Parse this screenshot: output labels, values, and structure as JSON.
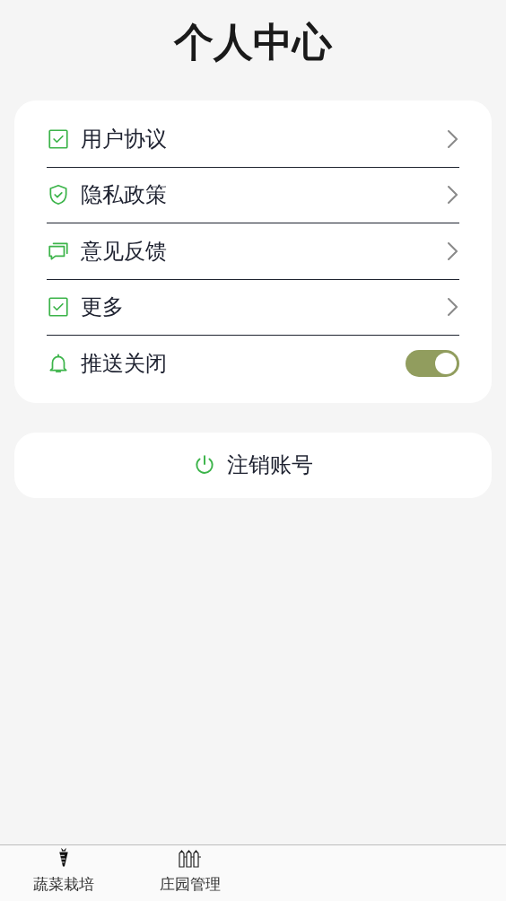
{
  "title": "个人中心",
  "menu": [
    {
      "kind": "link",
      "label": "用户协议"
    },
    {
      "kind": "link",
      "label": "隐私政策"
    },
    {
      "kind": "link",
      "label": "意见反馈"
    },
    {
      "kind": "link",
      "label": "更多"
    },
    {
      "kind": "toggle",
      "label": "推送关闭",
      "on": true
    }
  ],
  "logout_button": "注销账号",
  "tab_bar": [
    {
      "label": "蔬菜栽培"
    },
    {
      "label": "庄园管理"
    }
  ]
}
